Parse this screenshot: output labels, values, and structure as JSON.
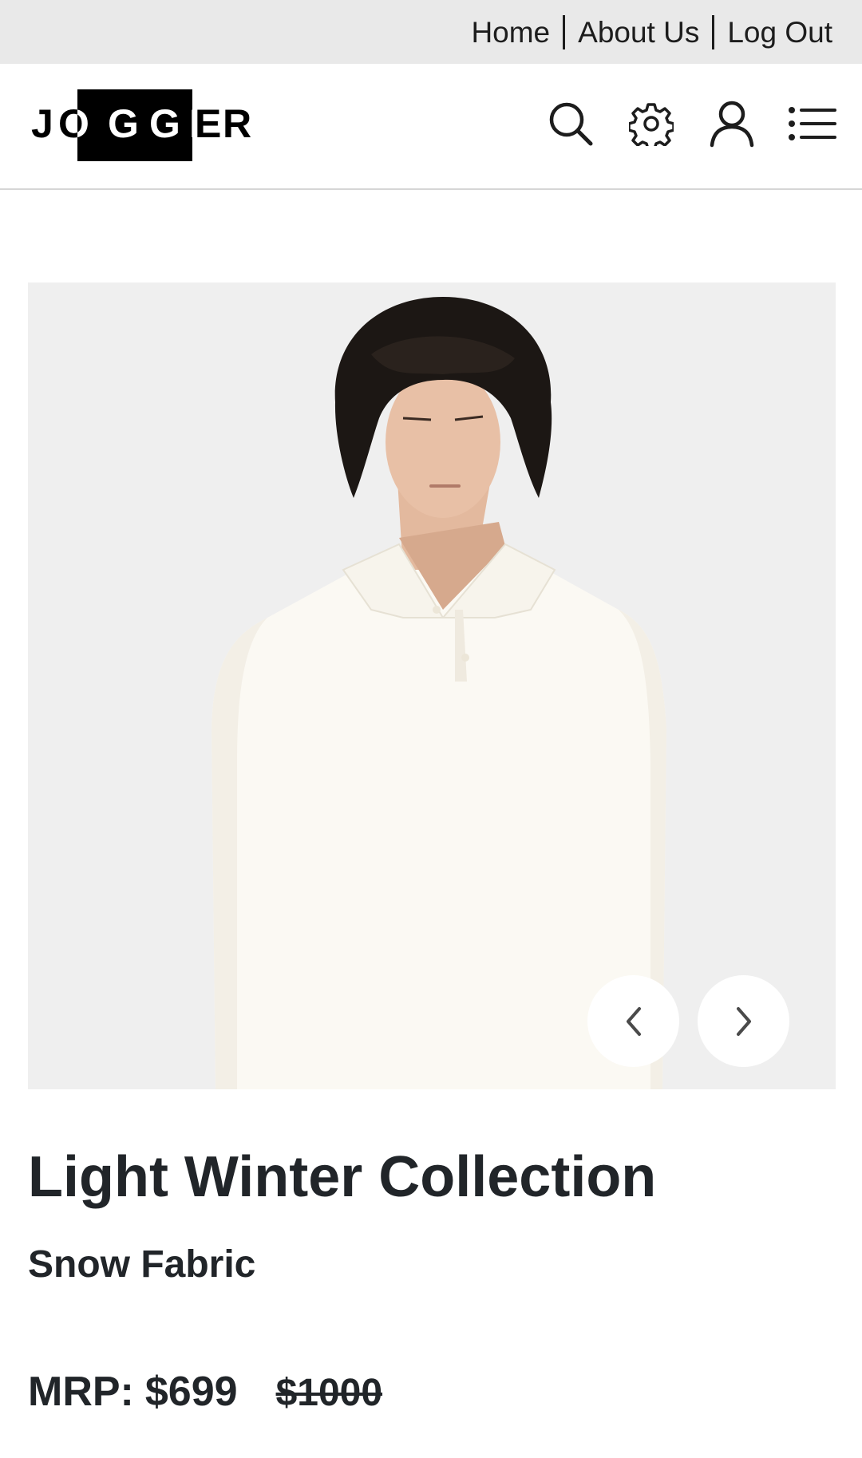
{
  "top_nav": {
    "links": [
      {
        "label": "Home"
      },
      {
        "label": "About Us"
      },
      {
        "label": "Log Out"
      }
    ]
  },
  "header": {
    "logo_text": "JOGGER",
    "icons": [
      "search-icon",
      "gear-icon",
      "user-icon",
      "menu-icon"
    ]
  },
  "product": {
    "image_alt": "Model wearing cream long-sleeve polo sweatshirt",
    "title": "Light Winter Collection",
    "subtitle": "Snow Fabric",
    "price_label": "MRP:",
    "price_current": "$699",
    "price_original": "$1000"
  },
  "carousel": {
    "prev_icon": "chevron-left-icon",
    "next_icon": "chevron-right-icon"
  },
  "colors": {
    "top_bar_bg": "#e9e9e9",
    "text": "#212529",
    "image_bg": "#ededed",
    "logo_block": "#000000"
  }
}
